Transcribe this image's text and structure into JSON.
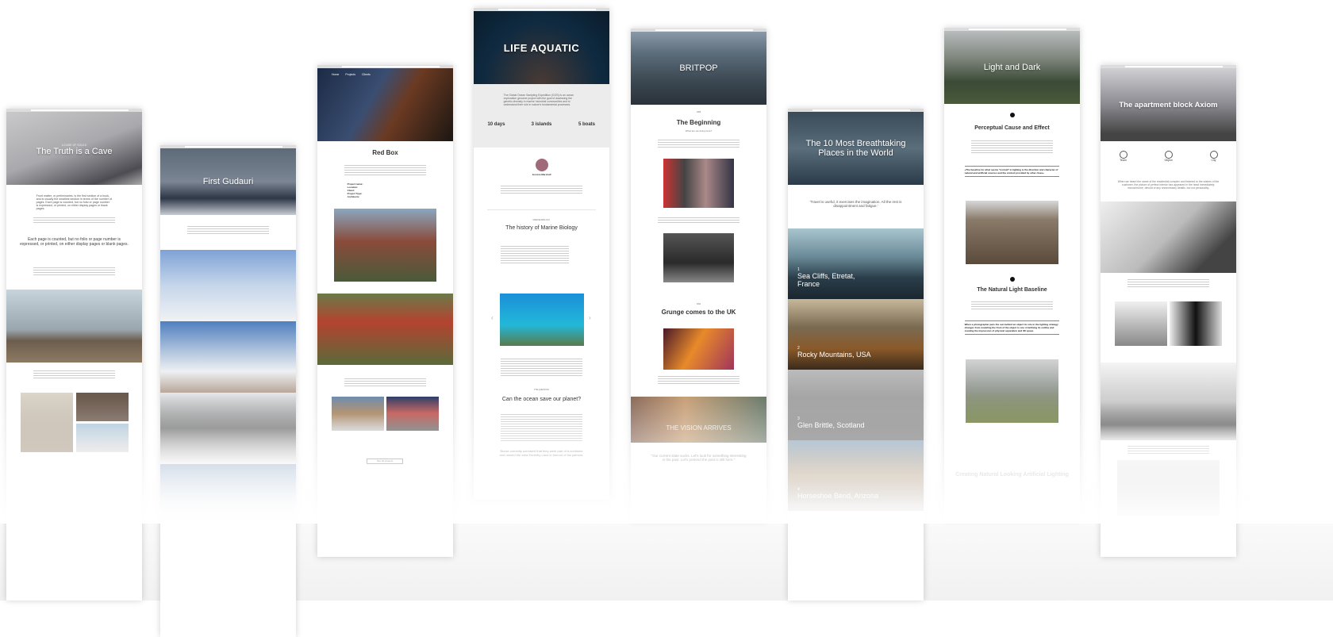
{
  "templates": [
    {
      "kicker": "A CASE OF SOULS",
      "title": "The Truth is a Cave",
      "body_lead": "Front matter, or preliminaries, is the first section of a book, and is usually the smallest section in terms of the number of pages. Each page is counted, but no folio or page number is expressed, or printed, on either display pages or blank pages.",
      "pullquote": "Each page is counted, but no folio or page number is expressed, or printed, on either display pages or blank pages."
    },
    {
      "title": "First Gudauri"
    },
    {
      "nav": [
        "Home",
        "Projects",
        "Clients"
      ],
      "title": "Red Box",
      "meta": [
        "Project name:",
        "Location:",
        "Client:",
        "Project Type:",
        "Architects:"
      ],
      "button": "See all projects"
    },
    {
      "title": "LIFE AQUATIC",
      "intro": "The Global Ocean Sampling Expedition (GOS) is an ocean exploration genome project with the goal of assessing the genetic diversity in marine microbial communities and to understand their role in nature's fundamental processes.",
      "stats": [
        "10 days",
        "3 islands",
        "5 boats"
      ],
      "author": "Jessica Marshall",
      "kicker": "MARINE BIOLOGY",
      "heading": "The history of Marine Biology",
      "kicker2": "THE QUESTION",
      "heading2": "Can the ocean save our planet?",
      "quote": "Bocse correctly surmised that they were part of a continent and named the area Enderby Land in honour of his patrons."
    },
    {
      "title": "BRITPOP",
      "kicker": "1985",
      "heading": "The Beginning",
      "sub": "What are we doing here?",
      "kicker2": "1991",
      "heading2": "Grunge comes to the UK",
      "banner": "THE VISION ARRIVES",
      "quote": "\"Our current state sucks. Let's look for something interesting in the past. Let's pretend the past is still here.\""
    },
    {
      "title": "The 10 Most Breathtaking Places in the World",
      "quote": "'Travel is useful, it exercises the imagination. All the rest is disappointment and fatigue.'",
      "places": [
        {
          "n": "1",
          "name": "Sea Cliffs, Etretat, France"
        },
        {
          "n": "2",
          "name": "Rocky Mountains, USA"
        },
        {
          "n": "3",
          "name": "Glen Brittle, Scotland"
        },
        {
          "n": "4",
          "name": "Horseshoe Bend, Arizona"
        }
      ]
    },
    {
      "title": "Light and Dark",
      "heading": "Perceptual Cause and Effect",
      "quote": "«The baseline for what seems \"normal\" in lighting is the direction and character of natural and artificial sources and the context provided by other clues»",
      "heading2": "The Natural Light Baseline",
      "quote2": "When a photographer puts the sun behind an object its role in the lighting strategy changes from modeling the front of the object to one of defining its outline and creating the impression of physical separation and 3D space.",
      "heading3": "Creating Natural Looking Artificial Lighting"
    },
    {
      "title": "The apartment block Axiom",
      "features": [
        "Team",
        "Object",
        "City"
      ],
      "body": "When we heard the name of the residential complex and listened to the wishes of the customer, the picture of perfect interior has appeared in the head immediately: monochrome, devoid of any unnecessary details, but not personality."
    }
  ]
}
